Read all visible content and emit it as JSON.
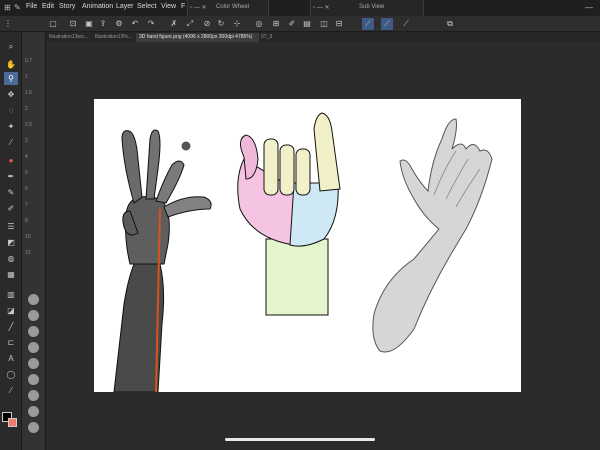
{
  "menubar": {
    "items": [
      "File",
      "Edit",
      "Story",
      "Animation",
      "Layer",
      "Select",
      "View",
      "F"
    ],
    "color_wheel_title": "Color Wheel",
    "sub_view_title": "Sub View"
  },
  "tabs": [
    {
      "label": "Illustration13wo..."
    },
    {
      "label": "Illustration13%..."
    },
    {
      "label": "3D hand figure.png (4096 x 2800px 300dpi 4785%)"
    },
    {
      "label": "07_3"
    }
  ],
  "colors": {
    "accent": "#4a6b9a",
    "foreground": "#000000",
    "background_color": "#f07b6a"
  }
}
